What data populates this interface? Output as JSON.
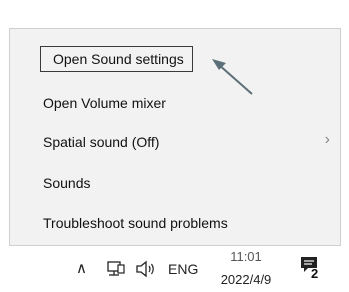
{
  "menu": {
    "items": [
      {
        "label": "Open Sound settings"
      },
      {
        "label": "Open Volume mixer"
      },
      {
        "label": "Spatial sound (Off)"
      },
      {
        "label": "Sounds"
      },
      {
        "label": "Troubleshoot sound problems"
      }
    ],
    "submenu_glyph": "›"
  },
  "taskbar": {
    "chevron_glyph": "∧",
    "language": "ENG",
    "clock_time": "11:01",
    "clock_date": "2022/4/9",
    "notification_count": "2"
  },
  "icons": [
    "chevron-up-icon",
    "network-icon",
    "speaker-icon",
    "notification-icon",
    "annotation-arrow-icon"
  ],
  "colors": {
    "menu_bg": "#f2f2f2",
    "highlight_border": "#3a3a3a",
    "text": "#111111"
  }
}
